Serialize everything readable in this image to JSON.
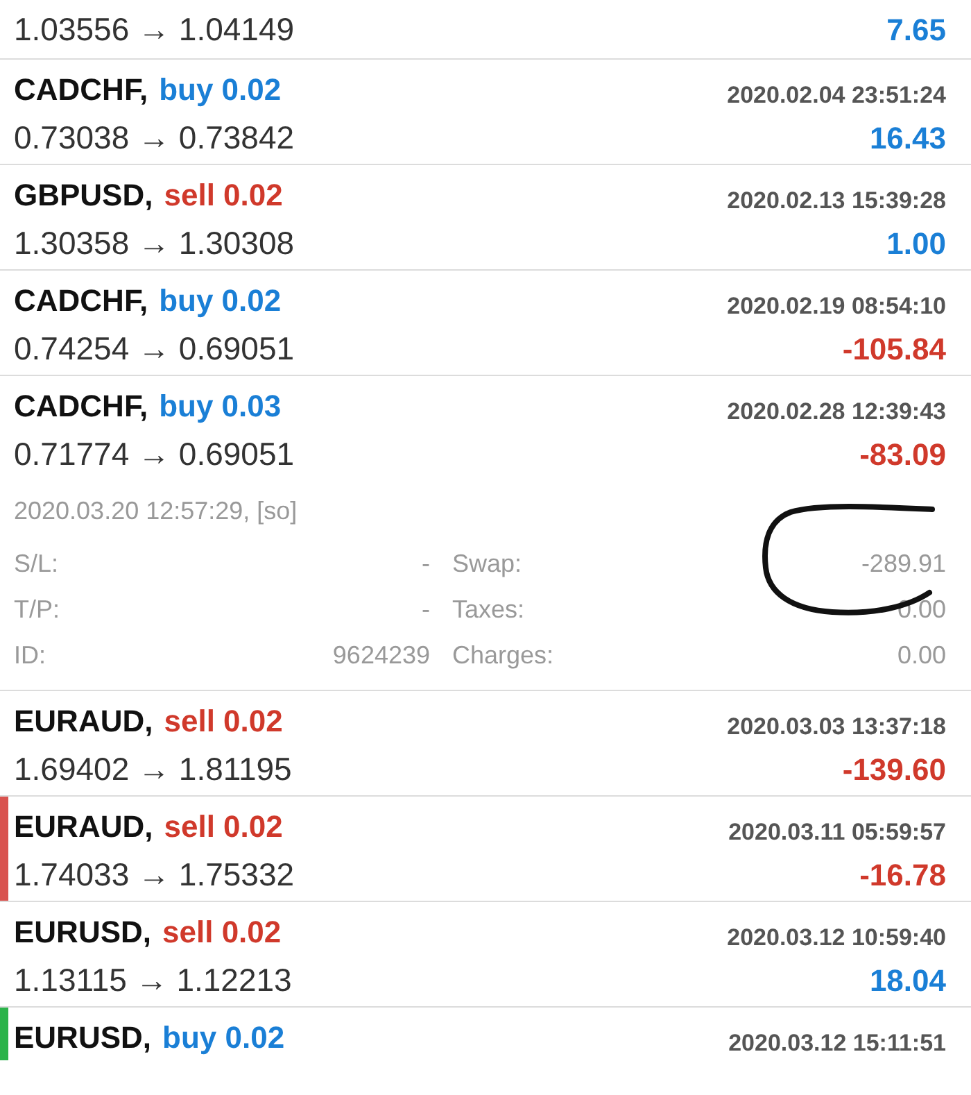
{
  "trades": [
    {
      "prices": "1.03556 → 1.04149",
      "profit": {
        "text": "7.65",
        "kind": "gain"
      }
    },
    {
      "symbol": "CADCHF,",
      "side": {
        "text": "buy 0.02",
        "kind": "buy"
      },
      "time": "2020.02.04 23:51:24",
      "prices": "0.73038 → 0.73842",
      "profit": {
        "text": "16.43",
        "kind": "gain"
      }
    },
    {
      "symbol": "GBPUSD,",
      "side": {
        "text": "sell 0.02",
        "kind": "sell"
      },
      "time": "2020.02.13 15:39:28",
      "prices": "1.30358 → 1.30308",
      "profit": {
        "text": "1.00",
        "kind": "gain"
      }
    },
    {
      "symbol": "CADCHF,",
      "side": {
        "text": "buy 0.02",
        "kind": "buy"
      },
      "time": "2020.02.19 08:54:10",
      "prices": "0.74254 → 0.69051",
      "profit": {
        "text": "-105.84",
        "kind": "loss"
      }
    },
    {
      "symbol": "CADCHF,",
      "side": {
        "text": "buy 0.03",
        "kind": "buy"
      },
      "time": "2020.02.28 12:39:43",
      "prices": "0.71774 → 0.69051",
      "profit": {
        "text": "-83.09",
        "kind": "loss"
      },
      "expanded": true,
      "details": {
        "close_time": "2020.03.20 12:57:29, [so]",
        "left": [
          {
            "label": "S/L:",
            "value": "-"
          },
          {
            "label": "T/P:",
            "value": "-"
          },
          {
            "label": "ID:",
            "value": "9624239"
          }
        ],
        "right": [
          {
            "label": "Swap:",
            "value": "-289.91"
          },
          {
            "label": "Taxes:",
            "value": "0.00"
          },
          {
            "label": "Charges:",
            "value": "0.00"
          }
        ]
      }
    },
    {
      "symbol": "EURAUD,",
      "side": {
        "text": "sell 0.02",
        "kind": "sell"
      },
      "time": "2020.03.03 13:37:18",
      "prices": "1.69402 → 1.81195",
      "profit": {
        "text": "-139.60",
        "kind": "loss"
      }
    },
    {
      "symbol": "EURAUD,",
      "side": {
        "text": "sell 0.02",
        "kind": "sell"
      },
      "time": "2020.03.11 05:59:57",
      "prices": "1.74033 → 1.75332",
      "profit": {
        "text": "-16.78",
        "kind": "loss"
      },
      "color": "#d9534f"
    },
    {
      "symbol": "EURUSD,",
      "side": {
        "text": "sell 0.02",
        "kind": "sell"
      },
      "time": "2020.03.12 10:59:40",
      "prices": "1.13115 → 1.12213",
      "profit": {
        "text": "18.04",
        "kind": "gain"
      }
    },
    {
      "symbol": "EURUSD,",
      "side": {
        "text": "buy 0.02",
        "kind": "buy"
      },
      "time": "2020.03.12 15:11:51",
      "color": "#2bb34a"
    }
  ]
}
